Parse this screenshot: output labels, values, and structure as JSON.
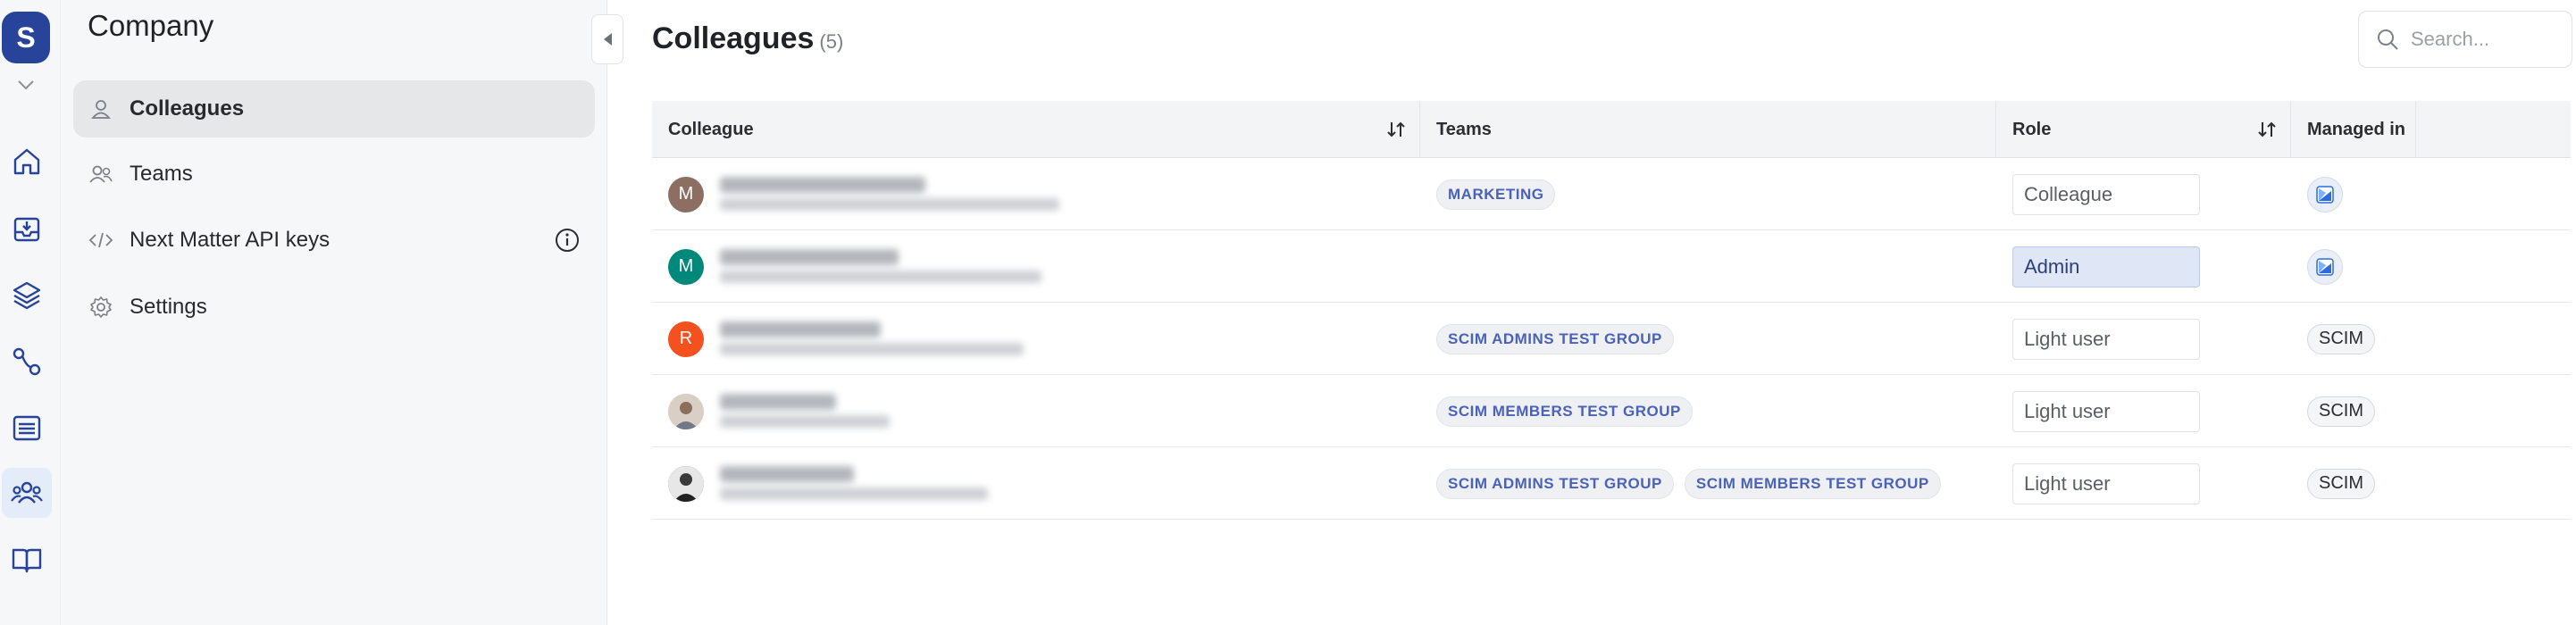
{
  "app": {
    "logo_letter": "S",
    "accent": "#27439a"
  },
  "sidebar": {
    "title": "Company",
    "items": [
      {
        "label": "Colleagues",
        "icon": "user-icon",
        "active": true
      },
      {
        "label": "Teams",
        "icon": "users-icon",
        "active": false
      },
      {
        "label": "Next Matter API keys",
        "icon": "code-icon",
        "active": false
      },
      {
        "label": "Settings",
        "icon": "gear-icon",
        "active": false
      }
    ]
  },
  "main": {
    "title": "Colleagues",
    "count": "(5)",
    "search_placeholder": "Search..."
  },
  "table": {
    "headers": {
      "colleague": "Colleague",
      "teams": "Teams",
      "role": "Role",
      "managed_in": "Managed in"
    },
    "rows": [
      {
        "avatar_letter": "M",
        "avatar_color": "#8d6e63",
        "teams": [
          "MARKETING"
        ],
        "role": "Colleague",
        "managed": "icon"
      },
      {
        "avatar_letter": "M",
        "avatar_color": "#00897b",
        "teams": [],
        "role": "Admin",
        "managed": "icon"
      },
      {
        "avatar_letter": "R",
        "avatar_color": "#f4511e",
        "teams": [
          "SCIM ADMINS TEST GROUP"
        ],
        "role": "Light user",
        "managed": "SCIM"
      },
      {
        "avatar_letter": "",
        "avatar_color": "#9aa0a6",
        "teams": [
          "SCIM MEMBERS TEST GROUP"
        ],
        "role": "Light user",
        "managed": "SCIM"
      },
      {
        "avatar_letter": "",
        "avatar_color": "#4b4f55",
        "teams": [
          "SCIM ADMINS TEST GROUP",
          "SCIM MEMBERS TEST GROUP"
        ],
        "role": "Light user",
        "managed": "SCIM"
      }
    ]
  }
}
